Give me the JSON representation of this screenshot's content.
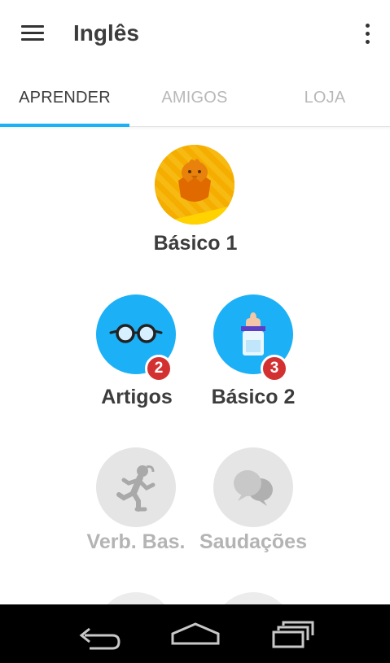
{
  "appbar": {
    "title": "Inglês",
    "menu_icon": "hamburger-menu-icon",
    "more_icon": "more-vertical-icon"
  },
  "tabs": [
    {
      "label": "APRENDER",
      "active": true
    },
    {
      "label": "AMIGOS",
      "active": false
    },
    {
      "label": "LOJA",
      "active": false
    }
  ],
  "colors": {
    "accent": "#1cb0f6",
    "gold": "#f7b500",
    "badge": "#d33131",
    "locked": "#e5e5e5",
    "locked_text": "#b4b4b4",
    "text": "#3c3c3c"
  },
  "skills": [
    {
      "name": "Básico 1",
      "icon": "hatching-chick-icon",
      "state": "gold"
    },
    {
      "name": "Artigos",
      "icon": "glasses-icon",
      "state": "unlocked",
      "badge": "2"
    },
    {
      "name": "Básico 2",
      "icon": "baby-bottle-icon",
      "state": "unlocked",
      "badge": "3"
    },
    {
      "name": "Verb. Bas.",
      "icon": "running-person-icon",
      "state": "locked"
    },
    {
      "name": "Saudações",
      "icon": "speech-bubbles-icon",
      "state": "locked"
    }
  ],
  "system_nav": {
    "back_icon": "back-icon",
    "home_icon": "home-icon",
    "recents_icon": "recent-apps-icon"
  }
}
